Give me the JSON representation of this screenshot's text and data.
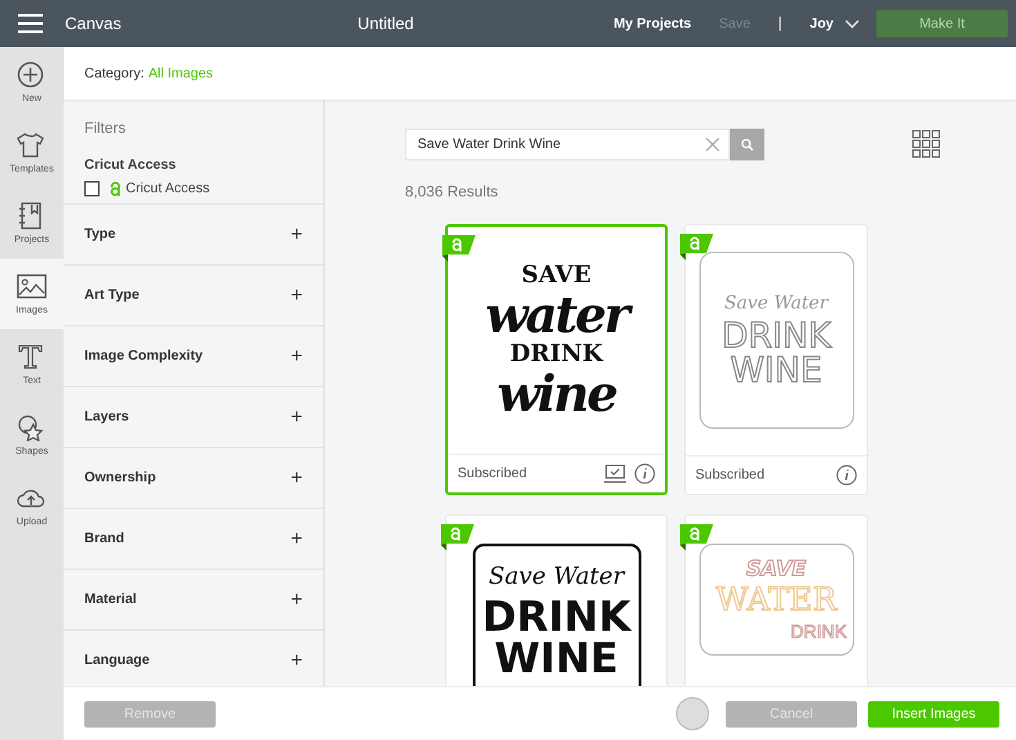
{
  "topbar": {
    "app": "Canvas",
    "title": "Untitled",
    "links": [
      {
        "label": "My Projects",
        "disabled": false
      },
      {
        "label": "Save",
        "disabled": true
      }
    ],
    "separator": "|",
    "user": "Joy",
    "action": {
      "label": "Make It",
      "disabled": true
    }
  },
  "rail": [
    {
      "label": "New",
      "kind": "plus",
      "selected": false
    },
    {
      "label": "Templates",
      "kind": "shirt",
      "selected": false
    },
    {
      "label": "Projects",
      "kind": "notebook",
      "selected": false
    },
    {
      "label": "Images",
      "kind": "picture",
      "selected": true
    },
    {
      "label": "Text",
      "kind": "text",
      "selected": false
    },
    {
      "label": "Shapes",
      "kind": "shapes",
      "selected": false
    },
    {
      "label": "Upload",
      "kind": "upload",
      "selected": false
    }
  ],
  "category": {
    "label": "Category:",
    "value": "All Images"
  },
  "filters": {
    "title": "Filters",
    "access": {
      "heading": "Cricut Access",
      "option": "Cricut Access",
      "checked": false
    },
    "groups": [
      {
        "label": "Type",
        "expand": "+"
      },
      {
        "label": "Art Type",
        "expand": "+"
      },
      {
        "label": "Image Complexity",
        "expand": "+"
      },
      {
        "label": "Layers",
        "expand": "+"
      },
      {
        "label": "Ownership",
        "expand": "+"
      },
      {
        "label": "Brand",
        "expand": "+"
      },
      {
        "label": "Material",
        "expand": "+"
      },
      {
        "label": "Language",
        "expand": "+"
      }
    ]
  },
  "search": {
    "value": "Save Water Drink Wine"
  },
  "results": "8,036 Results",
  "cards": [
    {
      "selected": true,
      "status": "Subscribed",
      "in_canvas": true,
      "kind": "plain",
      "art": [
        {
          "text": "SAVE",
          "kind": "serif"
        },
        {
          "text": "water",
          "kind": "script"
        },
        {
          "text": "DRINK",
          "kind": "serif"
        },
        {
          "text": "wine",
          "kind": "script"
        }
      ]
    },
    {
      "selected": false,
      "status": "Subscribed",
      "in_canvas": false,
      "kind": "outline",
      "art": [
        {
          "text": "Save Water",
          "kind": "outline-script"
        },
        {
          "text": "DRINK",
          "kind": "outline"
        },
        {
          "text": "WINE",
          "kind": "outline"
        }
      ]
    },
    {
      "selected": false,
      "kind": "solid",
      "art": [
        {
          "text": "Save Water",
          "kind": "script-small"
        },
        {
          "text": "DRINK",
          "kind": "sans"
        },
        {
          "text": "WINE",
          "kind": "sans"
        }
      ]
    },
    {
      "selected": false,
      "kind": "outline",
      "art": [
        {
          "text": "SAVE",
          "kind": "rose-outline"
        },
        {
          "text": "WATER",
          "kind": "amber-outline"
        },
        {
          "text": "DRINK",
          "kind": "rose-small"
        }
      ]
    }
  ],
  "footer": {
    "buttons": [
      {
        "label": "Remove",
        "kind": "grey",
        "disabled": true
      },
      {
        "label": "Cancel",
        "kind": "grey",
        "disabled": true
      },
      {
        "label": "Insert Images",
        "kind": "primary",
        "disabled": false
      }
    ]
  }
}
